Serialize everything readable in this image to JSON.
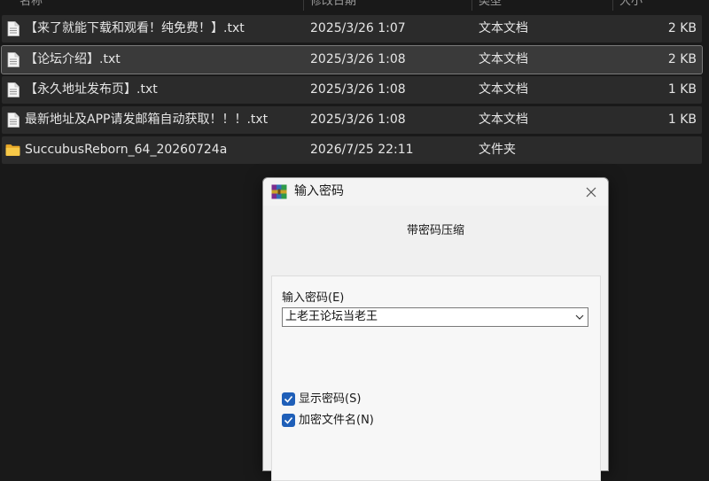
{
  "columns": {
    "name": "名称",
    "date": "修改日期",
    "type": "类型",
    "size": "大小"
  },
  "files": [
    {
      "name": "【来了就能下载和观看！纯免费！】.txt",
      "date": "2025/3/26 1:07",
      "type": "文本文档",
      "size": "2 KB",
      "icon": "text-file-icon"
    },
    {
      "name": "【论坛介绍】.txt",
      "date": "2025/3/26 1:08",
      "type": "文本文档",
      "size": "2 KB",
      "icon": "text-file-icon",
      "selected": true
    },
    {
      "name": "【永久地址发布页】.txt",
      "date": "2025/3/26 1:08",
      "type": "文本文档",
      "size": "1 KB",
      "icon": "text-file-icon"
    },
    {
      "name": "最新地址及APP请发邮箱自动获取！！！.txt",
      "date": "2025/3/26 1:08",
      "type": "文本文档",
      "size": "1 KB",
      "icon": "text-file-icon"
    },
    {
      "name": "SuccubusReborn_64_20260724a",
      "date": "2026/7/25 22:11",
      "type": "文件夹",
      "size": "",
      "icon": "folder-icon"
    }
  ],
  "dialog": {
    "title": "输入密码",
    "heading": "带密码压缩",
    "password_label": "输入密码(E)",
    "password_value": "上老王论坛当老王",
    "show_password_label": "显示密码(S)",
    "show_password_checked": true,
    "encrypt_names_label": "加密文件名(N)",
    "encrypt_names_checked": true
  },
  "colors": {
    "explorer_bg": "#191919",
    "row_bg": "#2b2b2b",
    "selected_row_bg": "#3a3a3a",
    "checkbox_accent": "#1f5fb8",
    "folder": "#f2c14e"
  }
}
